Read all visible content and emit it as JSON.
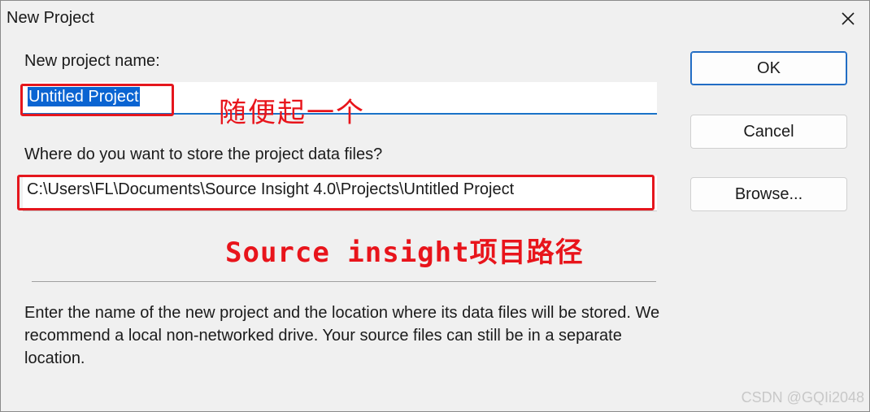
{
  "window": {
    "title": "New Project",
    "close_icon": "close-icon"
  },
  "form": {
    "name_label": "New project name:",
    "name_value": "Untitled Project",
    "path_label": "Where do you want to store the project data files?",
    "path_value": "C:\\Users\\FL\\Documents\\Source Insight 4.0\\Projects\\Untitled Project",
    "description": "Enter the name of the new project and the location where its data files will be stored. We recommend a local non-networked drive. Your source files can still be in a separate location."
  },
  "buttons": {
    "ok": "OK",
    "cancel": "Cancel",
    "browse": "Browse..."
  },
  "annotations": {
    "name_note": "随便起一个",
    "path_note": "Source insight项目路径",
    "color": "#e5161d"
  },
  "watermark": "CSDN @GQIi2048"
}
